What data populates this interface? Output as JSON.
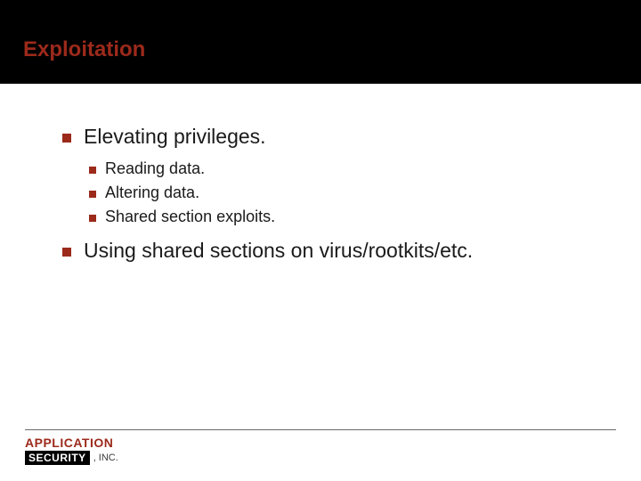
{
  "title": "Exploitation",
  "bullets": {
    "b1": "Elevating privileges.",
    "b1_subs": {
      "s1": "Reading data.",
      "s2": "Altering data.",
      "s3": "Shared section exploits."
    },
    "b2": "Using shared sections on virus/rootkits/etc."
  },
  "logo": {
    "line1": "APPLICATION",
    "sec": "SECURITY",
    "inc": ", INC."
  }
}
